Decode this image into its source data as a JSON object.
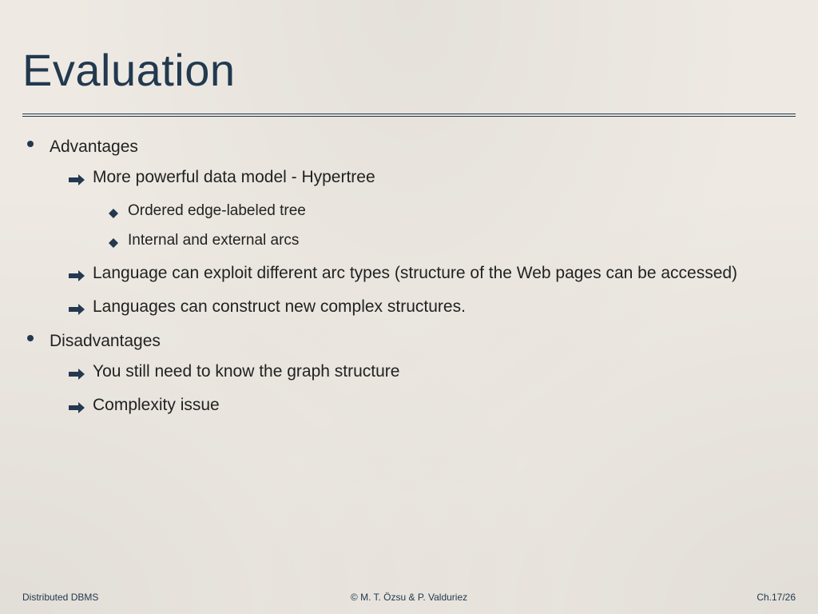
{
  "title": "Evaluation",
  "bullets": {
    "advantages": {
      "label": "Advantages",
      "items": [
        {
          "text": "More powerful data model - Hypertree",
          "sub": [
            "Ordered edge-labeled tree",
            "Internal and external arcs"
          ]
        },
        {
          "text": "Language can exploit different arc types (structure of the Web pages can be accessed)"
        },
        {
          "text": "Languages can construct new complex structures."
        }
      ]
    },
    "disadvantages": {
      "label": "Disadvantages",
      "items": [
        {
          "text": "You still need to know the graph structure"
        },
        {
          "text": "Complexity issue"
        }
      ]
    }
  },
  "footer": {
    "left": "Distributed DBMS",
    "center": "© M. T. Özsu & P. Valduriez",
    "right": "Ch.17/26"
  }
}
